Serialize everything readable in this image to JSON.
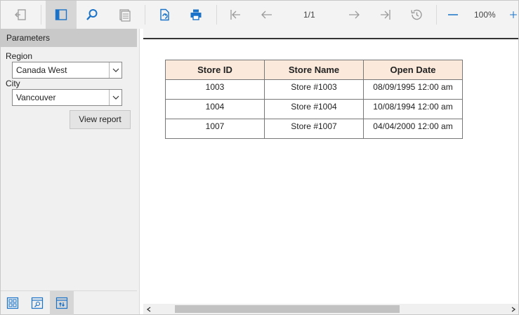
{
  "toolbar": {
    "page_indicator": "1/1",
    "zoom": "100%",
    "icon_color": "#1a73c8",
    "disabled_color": "#9a9a9a"
  },
  "params_panel": {
    "header": "Parameters",
    "region_label": "Region",
    "region_value": "Canada West",
    "city_label": "City",
    "city_value": "Vancouver",
    "view_button": "View report"
  },
  "report": {
    "columns": [
      "Store ID",
      "Store Name",
      "Open Date"
    ],
    "rows": [
      [
        "1003",
        "Store #1003",
        "08/09/1995 12:00 am"
      ],
      [
        "1004",
        "Store #1004",
        "10/08/1994 12:00 am"
      ],
      [
        "1007",
        "Store #1007",
        "04/04/2000 12:00 am"
      ]
    ],
    "header_bg": "#fbeadb"
  }
}
